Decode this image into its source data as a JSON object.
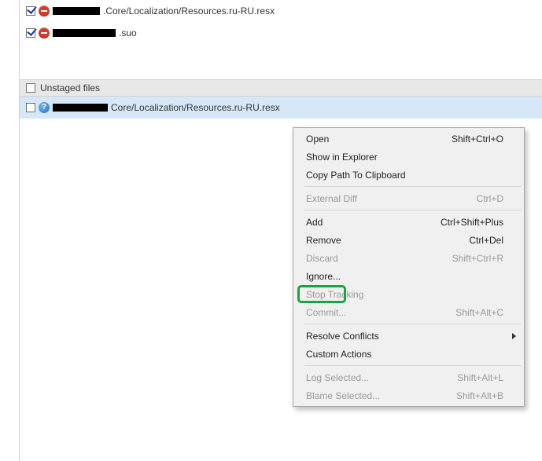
{
  "staged_files": [
    {
      "checked": true,
      "status": "deleted",
      "suffix": ".Core/Localization/Resources.ru-RU.resx"
    },
    {
      "checked": true,
      "status": "deleted",
      "suffix": ".suo"
    }
  ],
  "unstaged_header": "Unstaged files",
  "unstaged_files": [
    {
      "checked": false,
      "status": "help",
      "suffix": "Core/Localization/Resources.ru-RU.resx"
    }
  ],
  "context_menu": {
    "open": {
      "label": "Open",
      "shortcut": "Shift+Ctrl+O",
      "enabled": true
    },
    "show_explorer": {
      "label": "Show in Explorer",
      "shortcut": "",
      "enabled": true
    },
    "copy_path": {
      "label": "Copy Path To Clipboard",
      "shortcut": "",
      "enabled": true
    },
    "external_diff": {
      "label": "External Diff",
      "shortcut": "Ctrl+D",
      "enabled": false
    },
    "add": {
      "label": "Add",
      "shortcut": "Ctrl+Shift+Plus",
      "enabled": true
    },
    "remove": {
      "label": "Remove",
      "shortcut": "Ctrl+Del",
      "enabled": true
    },
    "discard": {
      "label": "Discard",
      "shortcut": "Shift+Ctrl+R",
      "enabled": false
    },
    "ignore": {
      "label": "Ignore...",
      "shortcut": "",
      "enabled": true
    },
    "stop_tracking": {
      "label": "Stop Tracking",
      "shortcut": "",
      "enabled": false
    },
    "commit": {
      "label": "Commit...",
      "shortcut": "Shift+Alt+C",
      "enabled": false
    },
    "resolve": {
      "label": "Resolve Conflicts",
      "shortcut": "",
      "enabled": true
    },
    "custom_actions": {
      "label": "Custom Actions",
      "shortcut": "",
      "enabled": true
    },
    "log_selected": {
      "label": "Log Selected...",
      "shortcut": "Shift+Alt+L",
      "enabled": false
    },
    "blame_selected": {
      "label": "Blame Selected...",
      "shortcut": "Shift+Alt+B",
      "enabled": false
    }
  }
}
